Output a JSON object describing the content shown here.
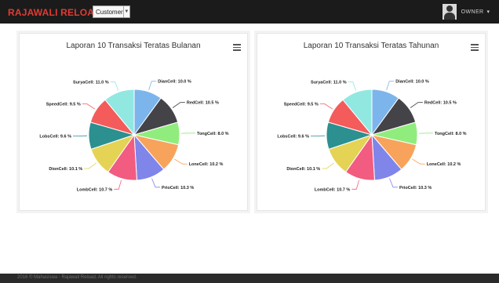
{
  "header": {
    "brand": "RAJAWALI RELOAD",
    "role_select": {
      "value": "Customer"
    },
    "user": {
      "name": "OWNER",
      "menu_icon": "chevron-down-icon",
      "avatar_icon": "user-avatar-icon"
    }
  },
  "panels": [
    {
      "title": "Laporan 10 Transaksi Teratas Bulanan",
      "menu_icon": "hamburger-menu-icon"
    },
    {
      "title": "Laporan 10 Transaksi Teratas Tahunan",
      "menu_icon": "hamburger-menu-icon"
    }
  ],
  "chart_data": [
    {
      "type": "pie",
      "title": "Laporan 10 Transaksi Teratas Bulanan",
      "slices": [
        {
          "label": "DianCell",
          "value": 10.0,
          "display": "DianCell: 10.0 %",
          "color": "#7cb5ec"
        },
        {
          "label": "RedCell",
          "value": 10.5,
          "display": "RedCell: 10.5 %",
          "color": "#434348"
        },
        {
          "label": "TongCell",
          "value": 8.0,
          "display": "TongCell: 8.0 %",
          "color": "#90ed7d"
        },
        {
          "label": "LoneCell",
          "value": 10.2,
          "display": "LoneCell: 10.2 %",
          "color": "#f7a35c"
        },
        {
          "label": "PrioCell",
          "value": 10.3,
          "display": "PrioCell: 10.3 %",
          "color": "#8085e9"
        },
        {
          "label": "LombCell",
          "value": 10.7,
          "display": "LombCell: 10.7 %",
          "color": "#f15c80"
        },
        {
          "label": "DionCell",
          "value": 10.1,
          "display": "DionCell: 10.1 %",
          "color": "#e4d354"
        },
        {
          "label": "LobsCell",
          "value": 9.6,
          "display": "LobsCell: 9.6 %",
          "color": "#2b908f"
        },
        {
          "label": "SpeedCell",
          "value": 9.5,
          "display": "SpeedCell: 9.5 %",
          "color": "#f45b5b"
        },
        {
          "label": "SuryaCell",
          "value": 11.0,
          "display": "SuryaCell: 11.0 %",
          "color": "#91e8e1"
        }
      ]
    },
    {
      "type": "pie",
      "title": "Laporan 10 Transaksi Teratas Tahunan",
      "slices": [
        {
          "label": "DianCell",
          "value": 10.0,
          "display": "DianCell: 10.0 %",
          "color": "#7cb5ec"
        },
        {
          "label": "RedCell",
          "value": 10.5,
          "display": "RedCell: 10.5 %",
          "color": "#434348"
        },
        {
          "label": "TongCell",
          "value": 8.0,
          "display": "TongCell: 8.0 %",
          "color": "#90ed7d"
        },
        {
          "label": "LoneCell",
          "value": 10.2,
          "display": "LoneCell: 10.2 %",
          "color": "#f7a35c"
        },
        {
          "label": "PrioCell",
          "value": 10.3,
          "display": "PrioCell: 10.3 %",
          "color": "#8085e9"
        },
        {
          "label": "LombCell",
          "value": 10.7,
          "display": "LombCell: 10.7 %",
          "color": "#f15c80"
        },
        {
          "label": "DionCell",
          "value": 10.1,
          "display": "DionCell: 10.1 %",
          "color": "#e4d354"
        },
        {
          "label": "LobsCell",
          "value": 9.6,
          "display": "LobsCell: 9.6 %",
          "color": "#2b908f"
        },
        {
          "label": "SpeedCell",
          "value": 9.5,
          "display": "SpeedCell: 9.5 %",
          "color": "#f45b5b"
        },
        {
          "label": "SuryaCell",
          "value": 11.0,
          "display": "SuryaCell: 11.0 %",
          "color": "#91e8e1"
        }
      ]
    }
  ],
  "footer": {
    "text": "2016 © Mahasiswa - Rajawali Reload. All rights reserved."
  }
}
